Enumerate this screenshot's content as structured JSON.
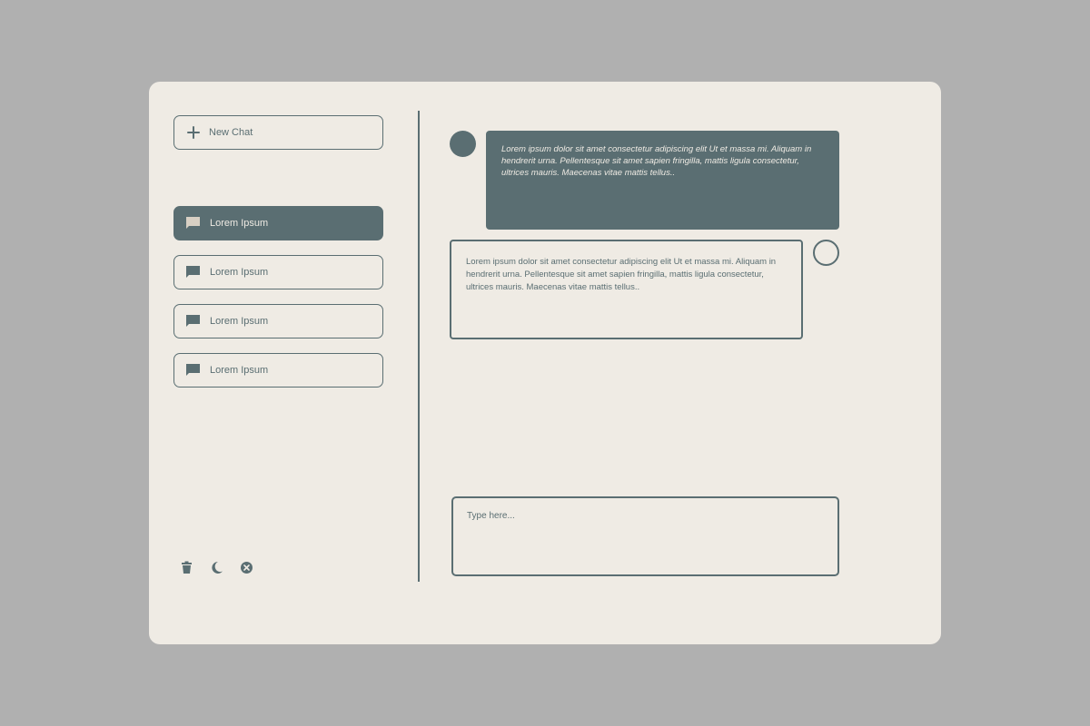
{
  "sidebar": {
    "new_chat_label": "New Chat",
    "chats": [
      {
        "label": "Lorem Ipsum",
        "active": true
      },
      {
        "label": "Lorem Ipsum",
        "active": false
      },
      {
        "label": "Lorem Ipsum",
        "active": false
      },
      {
        "label": "Lorem Ipsum",
        "active": false
      }
    ],
    "bottom_icons": [
      "trash-icon",
      "moon-icon",
      "close-circle-icon"
    ]
  },
  "conversation": {
    "incoming_message": "Lorem ipsum dolor sit amet consectetur adipiscing elit Ut et massa mi. Aliquam in hendrerit urna. Pellentesque sit amet sapien fringilla, mattis ligula consectetur, ultrices mauris. Maecenas vitae mattis tellus..",
    "outgoing_message": "Lorem ipsum dolor sit amet consectetur adipiscing elit Ut et massa mi. Aliquam in hendrerit urna. Pellentesque sit amet sapien fringilla, mattis ligula consectetur, ultrices mauris. Maecenas vitae mattis tellus.."
  },
  "composer": {
    "placeholder": "Type here..."
  },
  "colors": {
    "accent": "#5a6e72",
    "panel_bg": "#efebe4",
    "page_bg": "#b0b0b0"
  }
}
